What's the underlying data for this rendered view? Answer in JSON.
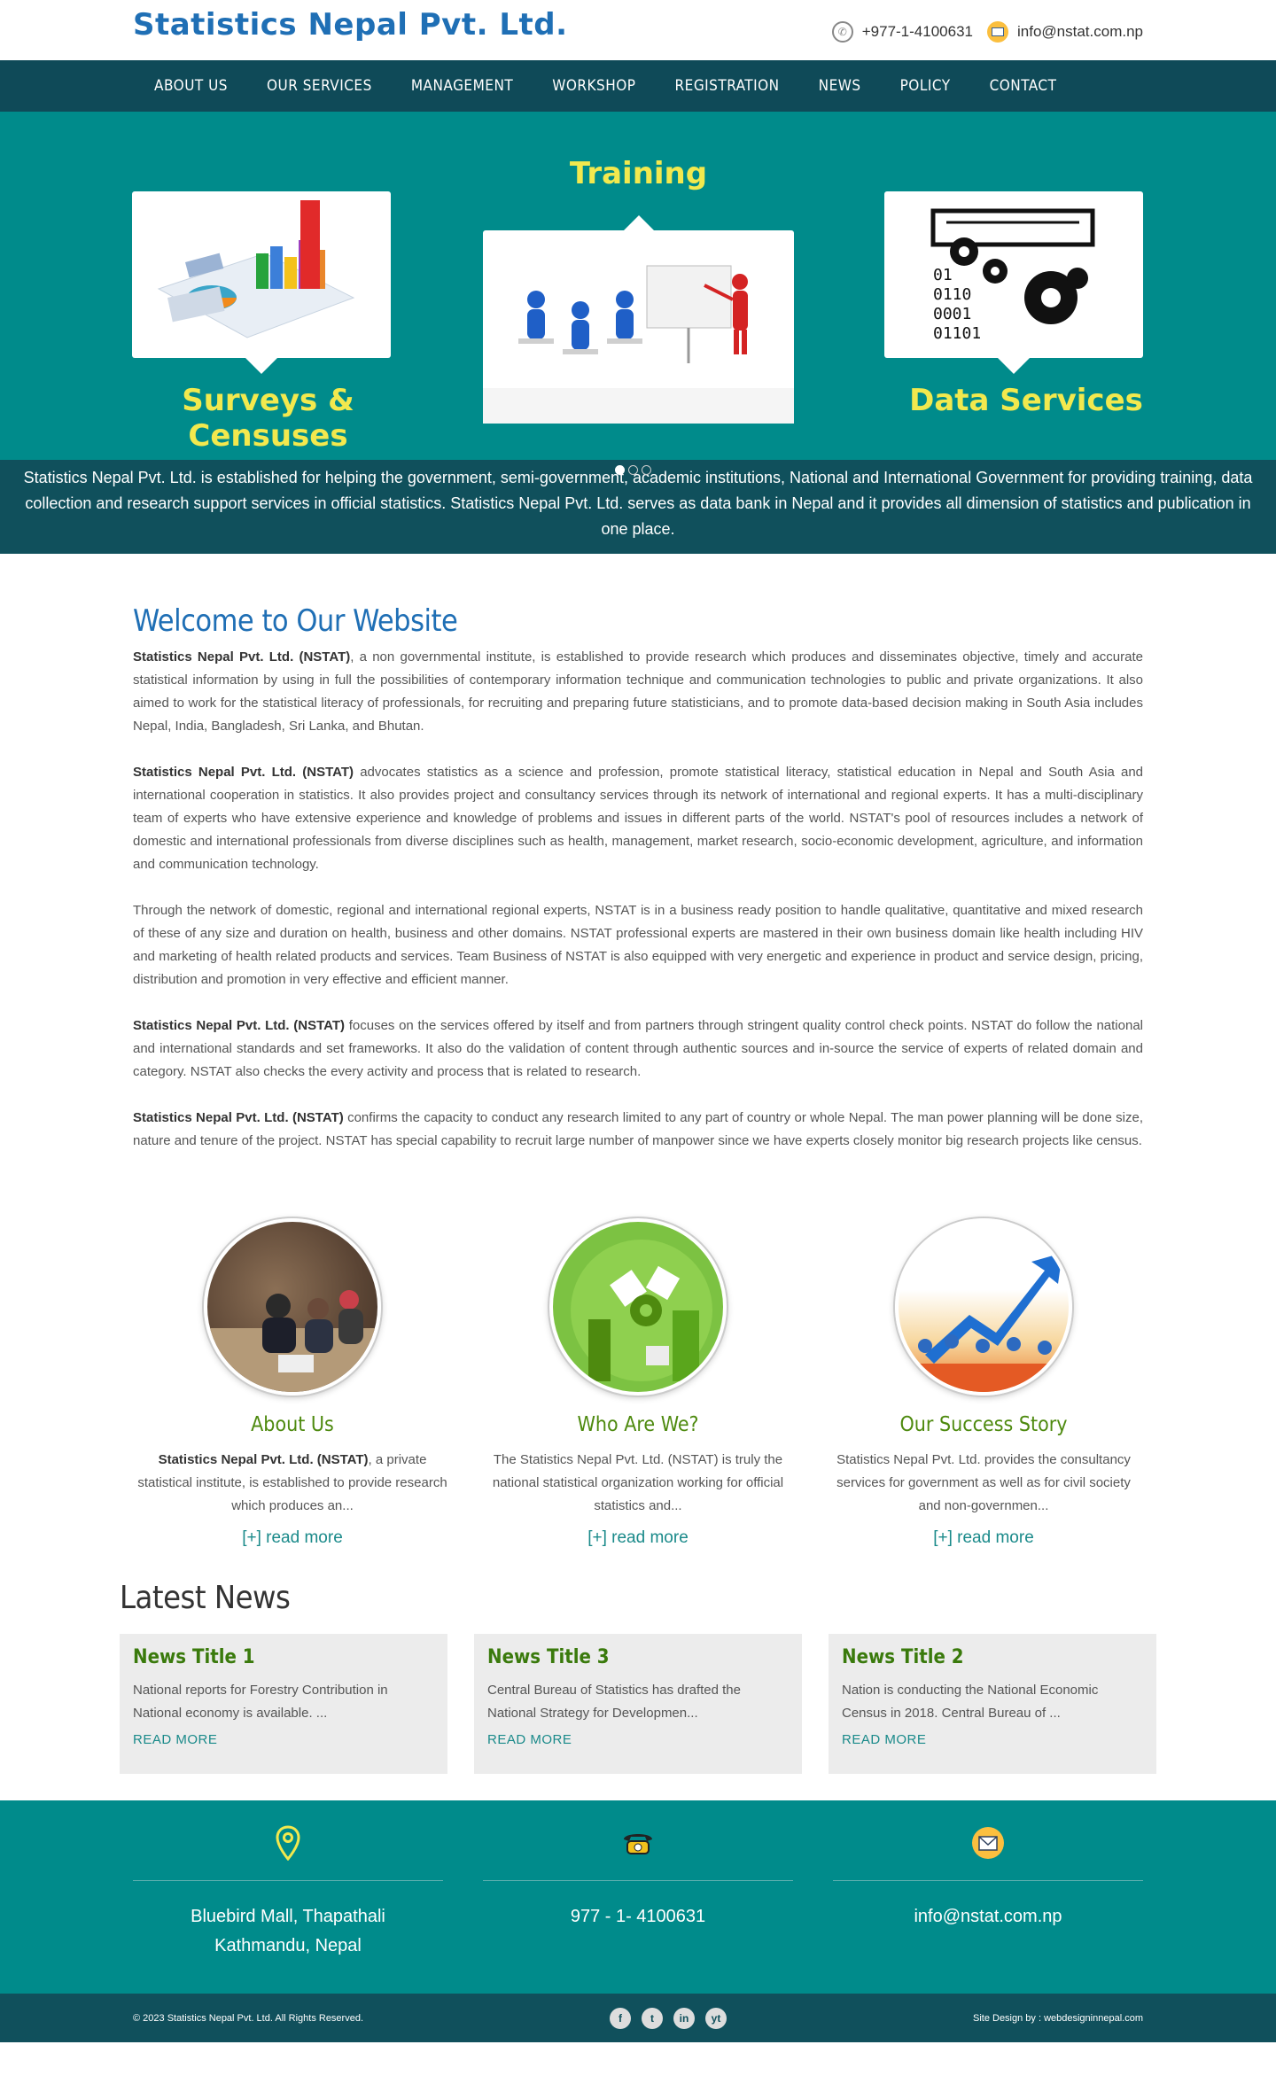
{
  "header": {
    "logo": "Statistics Nepal Pvt. Ltd.",
    "phone": "+977-1-4100631",
    "email": "info@nstat.com.np"
  },
  "nav": [
    "ABOUT US",
    "OUR SERVICES",
    "MANAGEMENT",
    "WORKSHOP",
    "REGISTRATION",
    "NEWS",
    "POLICY",
    "CONTACT"
  ],
  "hero": {
    "labels": {
      "left": "Surveys & Censuses",
      "middle": "Training",
      "right": "Data Services"
    },
    "data_icon_lines": [
      "01",
      "0110",
      "0001",
      "01101"
    ],
    "caption": "Statistics Nepal Pvt. Ltd. is established for helping the government, semi-government, academic institutions, National and International Government for providing training, data collection and research support services in official statistics. Statistics Nepal Pvt. Ltd. serves as data bank in Nepal and it provides all dimension of statistics and publication in one place."
  },
  "welcome": {
    "title": "Welcome to Our Website",
    "paragraphs": [
      {
        "bold": "Statistics Nepal Pvt. Ltd. (NSTAT)",
        "text": ", a non governmental institute, is established to provide research which produces and disseminates objective, timely and accurate statistical information by using in full the possibilities of contemporary information technique and communication technologies to public and private organizations. It also aimed to work for the statistical literacy of professionals, for recruiting and preparing future statisticians, and to promote data-based decision making in South Asia includes Nepal, India, Bangladesh, Sri Lanka, and Bhutan."
      },
      {
        "bold": "Statistics Nepal Pvt. Ltd. (NSTAT)",
        "text": " advocates statistics as a science and profession, promote statistical literacy, statistical education in Nepal and South Asia and international cooperation in statistics. It also provides project and consultancy services through its network of international and regional experts. It has a multi-disciplinary team of experts who have extensive experience and knowledge of problems and issues in different parts of the world. NSTAT's pool of resources includes a network of domestic and international professionals from diverse disciplines such as health, management, market research, socio-economic development, agriculture, and information and communication technology."
      },
      {
        "bold": "",
        "text": "Through the network of domestic, regional and international regional experts, NSTAT is in a business ready position to handle qualitative, quantitative and mixed research of these of any size and duration on health, business and other domains. NSTAT professional experts are mastered in their own business domain like health including HIV and marketing of health related products and services. Team Business of NSTAT is also equipped with very energetic and experience in product and service design, pricing, distribution and promotion in very effective and efficient manner."
      },
      {
        "bold": "Statistics Nepal Pvt. Ltd. (NSTAT)",
        "text": " focuses on the services offered by itself and from partners through stringent quality control check points. NSTAT do follow the national and international standards and set frameworks. It also do the validation of content through authentic sources and in-source the service of experts of related domain and category. NSTAT also checks the every activity and process that is related to research."
      },
      {
        "bold": "Statistics Nepal Pvt. Ltd. (NSTAT)",
        "text": " confirms the capacity to conduct any research limited to any part of country or whole Nepal. The man power planning will be done size, nature and tenure of the project. NSTAT has special capability to recruit large number of manpower since we have experts closely monitor big research projects like census."
      }
    ]
  },
  "features": [
    {
      "title": "About Us",
      "bold": "Statistics Nepal Pvt. Ltd. (NSTAT)",
      "text": ", a private statistical institute, is established to provide research which produces an...",
      "link": "[+] read more"
    },
    {
      "title": "Who Are We?",
      "bold": "",
      "text": "The Statistics Nepal Pvt. Ltd. (NSTAT) is truly the national statistical organization working for official statistics and...",
      "link": "[+] read more"
    },
    {
      "title": "Our Success Story",
      "bold": "",
      "text": "Statistics Nepal Pvt. Ltd. provides the consultancy services for government as well as for civil society and non-governmen...",
      "link": "[+] read more"
    }
  ],
  "news": {
    "heading": "Latest News",
    "items": [
      {
        "title": "News Title 1",
        "text": "National reports for Forestry Contribution in National economy is available. ...",
        "link": "READ MORE"
      },
      {
        "title": "News Title 3",
        "text": "Central Bureau of Statistics has drafted the National Strategy for Developmen...",
        "link": "READ MORE"
      },
      {
        "title": "News Title 2",
        "text": "Nation is conducting the National Economic Census in 2018. Central Bureau of ...",
        "link": "READ MORE"
      }
    ]
  },
  "footer": {
    "address_line1": "Bluebird Mall, Thapathali",
    "address_line2": "Kathmandu, Nepal",
    "phone": "977 - 1- 4100631",
    "email": "info@nstat.com.np",
    "copyright": "© 2023 Statistics Nepal Pvt. Ltd. All Rights Reserved.",
    "credit": "Site Design by : webdesigninnepal.com",
    "social": [
      "f",
      "t",
      "in",
      "yt"
    ]
  },
  "colors": {
    "teal": "#008b8b",
    "dark_teal": "#10505c",
    "brand_blue": "#1f6fb5",
    "green": "#4e8a0f",
    "yellow": "#f2e94e"
  }
}
